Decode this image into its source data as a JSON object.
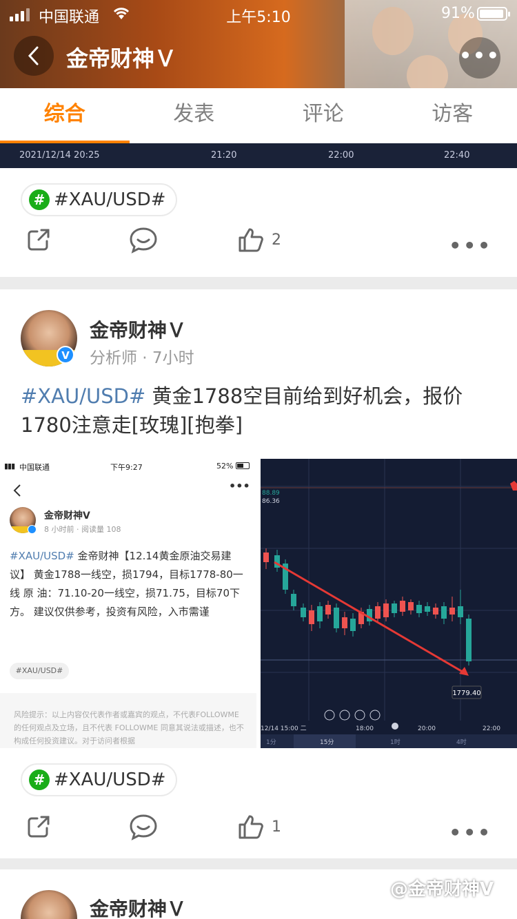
{
  "status_bar": {
    "carrier": "中国联通",
    "time": "上午5:10",
    "battery": "91%"
  },
  "header": {
    "title": "金帝财神Ｖ",
    "back_icon": "chevron-left-icon",
    "more_icon": "more-dots-icon"
  },
  "tabs": [
    {
      "label": "综合",
      "active": true
    },
    {
      "label": "发表",
      "active": false
    },
    {
      "label": "评论",
      "active": false
    },
    {
      "label": "访客",
      "active": false
    }
  ],
  "post1": {
    "chart_strip": {
      "date": "2021/12/14 20:25",
      "t1": "21:20",
      "t2": "22:00",
      "t3": "22:40"
    },
    "tag": "#XAU/USD#",
    "likes": "2"
  },
  "post2": {
    "author": "金帝财神Ｖ",
    "meta": "分析师 · 7小时",
    "topic": "#XAU/USD#",
    "text": " 黄金1788空目前给到好机会，报价1780注意走[玫瑰][抱拳]",
    "tag": "#XAU/USD#",
    "likes": "1",
    "embedded": {
      "carrier": "中国联通",
      "time": "下午9:27",
      "battery": "52%",
      "author": "金帝财神V",
      "meta": "8 小时前 · 阅读量 108",
      "topic": "#XAU/USD#",
      "body": " 金帝财神【12.14黄金原油交易建议】 黄金1788一线空，损1794，目标1778-80一线 原 油：71.10-20一线空，损71.75，目标70下方。 建议仅供参考，投资有风险，入市需谨",
      "tag": "#XAU/USD#",
      "risk": "风险提示：以上内容仅代表作者或嘉宾的观点，不代表FOLLOWME 的任何观点及立场，且不代表 FOLLOWME 同意其说法或描述，也不构成任何投资建议。对于访问者根据"
    },
    "chart": {
      "price_label": "1779.40",
      "top_labels": [
        "88.89",
        "86.36"
      ],
      "x_labels": [
        "12/14 15:00 二",
        "18:00",
        "20:00",
        "22:00"
      ],
      "timeframes": [
        "1分",
        "15分",
        "1时",
        "4时"
      ]
    }
  },
  "post3": {
    "author": "金帝财神Ｖ"
  },
  "watermark": "@金帝财神V"
}
